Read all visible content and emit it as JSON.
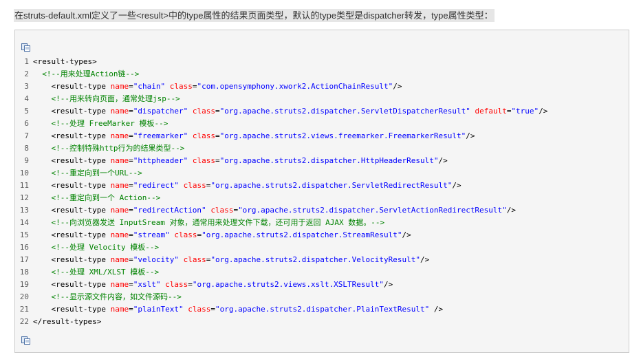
{
  "intro": "在struts-default.xml定义了一些<result>中的type属性的结果页面类型，默认的type类型是dispatcher转发，type属性类型：",
  "code_lines": [
    {
      "n": "1",
      "indent": "",
      "parts": [
        {
          "t": "tag",
          "v": "<result-types>"
        }
      ]
    },
    {
      "n": "2",
      "indent": "  ",
      "parts": [
        {
          "t": "cmt",
          "v": "<!--用来处理Action链-->"
        }
      ]
    },
    {
      "n": "3",
      "indent": "    ",
      "parts": [
        {
          "t": "tag",
          "v": "<result-type "
        },
        {
          "t": "attr",
          "v": "name"
        },
        {
          "t": "eq",
          "v": "="
        },
        {
          "t": "val",
          "v": "\"chain\""
        },
        {
          "t": "tag",
          "v": " "
        },
        {
          "t": "attr",
          "v": "class"
        },
        {
          "t": "eq",
          "v": "="
        },
        {
          "t": "val",
          "v": "\"com.opensymphony.xwork2.ActionChainResult\""
        },
        {
          "t": "tag",
          "v": "/>"
        }
      ]
    },
    {
      "n": "4",
      "indent": "    ",
      "parts": [
        {
          "t": "cmt",
          "v": "<!--用来转向页面，通常处理jsp-->"
        }
      ]
    },
    {
      "n": "5",
      "indent": "    ",
      "parts": [
        {
          "t": "tag",
          "v": "<result-type "
        },
        {
          "t": "attr",
          "v": "name"
        },
        {
          "t": "eq",
          "v": "="
        },
        {
          "t": "val",
          "v": "\"dispatcher\""
        },
        {
          "t": "tag",
          "v": " "
        },
        {
          "t": "attr",
          "v": "class"
        },
        {
          "t": "eq",
          "v": "="
        },
        {
          "t": "val",
          "v": "\"org.apache.struts2.dispatcher.ServletDispatcherResult\""
        },
        {
          "t": "tag",
          "v": " "
        },
        {
          "t": "attr",
          "v": "default"
        },
        {
          "t": "eq",
          "v": "="
        },
        {
          "t": "val",
          "v": "\"true\""
        },
        {
          "t": "tag",
          "v": "/>"
        }
      ]
    },
    {
      "n": "6",
      "indent": "    ",
      "parts": [
        {
          "t": "cmt",
          "v": "<!--处理 FreeMarker 模板-->"
        }
      ]
    },
    {
      "n": "7",
      "indent": "    ",
      "parts": [
        {
          "t": "tag",
          "v": "<result-type "
        },
        {
          "t": "attr",
          "v": "name"
        },
        {
          "t": "eq",
          "v": "="
        },
        {
          "t": "val",
          "v": "\"freemarker\""
        },
        {
          "t": "tag",
          "v": " "
        },
        {
          "t": "attr",
          "v": "class"
        },
        {
          "t": "eq",
          "v": "="
        },
        {
          "t": "val",
          "v": "\"org.apache.struts2.views.freemarker.FreemarkerResult\""
        },
        {
          "t": "tag",
          "v": "/>"
        }
      ]
    },
    {
      "n": "8",
      "indent": "    ",
      "parts": [
        {
          "t": "cmt",
          "v": "<!--控制特殊http行为的结果类型-->"
        }
      ]
    },
    {
      "n": "9",
      "indent": "    ",
      "parts": [
        {
          "t": "tag",
          "v": "<result-type "
        },
        {
          "t": "attr",
          "v": "name"
        },
        {
          "t": "eq",
          "v": "="
        },
        {
          "t": "val",
          "v": "\"httpheader\""
        },
        {
          "t": "tag",
          "v": " "
        },
        {
          "t": "attr",
          "v": "class"
        },
        {
          "t": "eq",
          "v": "="
        },
        {
          "t": "val",
          "v": "\"org.apache.struts2.dispatcher.HttpHeaderResult\""
        },
        {
          "t": "tag",
          "v": "/>"
        }
      ]
    },
    {
      "n": "10",
      "indent": "    ",
      "parts": [
        {
          "t": "cmt",
          "v": "<!--重定向到一个URL-->"
        }
      ]
    },
    {
      "n": "11",
      "indent": "    ",
      "parts": [
        {
          "t": "tag",
          "v": "<result-type "
        },
        {
          "t": "attr",
          "v": "name"
        },
        {
          "t": "eq",
          "v": "="
        },
        {
          "t": "val",
          "v": "\"redirect\""
        },
        {
          "t": "tag",
          "v": " "
        },
        {
          "t": "attr",
          "v": "class"
        },
        {
          "t": "eq",
          "v": "="
        },
        {
          "t": "val",
          "v": "\"org.apache.struts2.dispatcher.ServletRedirectResult\""
        },
        {
          "t": "tag",
          "v": "/>"
        }
      ]
    },
    {
      "n": "12",
      "indent": "    ",
      "parts": [
        {
          "t": "cmt",
          "v": "<!--重定向到一个 Action-->"
        }
      ]
    },
    {
      "n": "13",
      "indent": "    ",
      "parts": [
        {
          "t": "tag",
          "v": "<result-type "
        },
        {
          "t": "attr",
          "v": "name"
        },
        {
          "t": "eq",
          "v": "="
        },
        {
          "t": "val",
          "v": "\"redirectAction\""
        },
        {
          "t": "tag",
          "v": " "
        },
        {
          "t": "attr",
          "v": "class"
        },
        {
          "t": "eq",
          "v": "="
        },
        {
          "t": "val",
          "v": "\"org.apache.struts2.dispatcher.ServletActionRedirectResult\""
        },
        {
          "t": "tag",
          "v": "/>"
        }
      ]
    },
    {
      "n": "14",
      "indent": "    ",
      "parts": [
        {
          "t": "cmt",
          "v": "<!--向浏览器发送 InputSream 对象，通常用来处理文件下载，还可用于返回 AJAX 数据。-->"
        }
      ]
    },
    {
      "n": "15",
      "indent": "    ",
      "parts": [
        {
          "t": "tag",
          "v": "<result-type "
        },
        {
          "t": "attr",
          "v": "name"
        },
        {
          "t": "eq",
          "v": "="
        },
        {
          "t": "val",
          "v": "\"stream\""
        },
        {
          "t": "tag",
          "v": " "
        },
        {
          "t": "attr",
          "v": "class"
        },
        {
          "t": "eq",
          "v": "="
        },
        {
          "t": "val",
          "v": "\"org.apache.struts2.dispatcher.StreamResult\""
        },
        {
          "t": "tag",
          "v": "/>"
        }
      ]
    },
    {
      "n": "16",
      "indent": "    ",
      "parts": [
        {
          "t": "cmt",
          "v": "<!--处理 Velocity 模板-->"
        }
      ]
    },
    {
      "n": "17",
      "indent": "    ",
      "parts": [
        {
          "t": "tag",
          "v": "<result-type "
        },
        {
          "t": "attr",
          "v": "name"
        },
        {
          "t": "eq",
          "v": "="
        },
        {
          "t": "val",
          "v": "\"velocity\""
        },
        {
          "t": "tag",
          "v": " "
        },
        {
          "t": "attr",
          "v": "class"
        },
        {
          "t": "eq",
          "v": "="
        },
        {
          "t": "val",
          "v": "\"org.apache.struts2.dispatcher.VelocityResult\""
        },
        {
          "t": "tag",
          "v": "/>"
        }
      ]
    },
    {
      "n": "18",
      "indent": "    ",
      "parts": [
        {
          "t": "cmt",
          "v": "<!--处理 XML/XLST 模板-->"
        }
      ]
    },
    {
      "n": "19",
      "indent": "    ",
      "parts": [
        {
          "t": "tag",
          "v": "<result-type "
        },
        {
          "t": "attr",
          "v": "name"
        },
        {
          "t": "eq",
          "v": "="
        },
        {
          "t": "val",
          "v": "\"xslt\""
        },
        {
          "t": "tag",
          "v": " "
        },
        {
          "t": "attr",
          "v": "class"
        },
        {
          "t": "eq",
          "v": "="
        },
        {
          "t": "val",
          "v": "\"org.apache.struts2.views.xslt.XSLTResult\""
        },
        {
          "t": "tag",
          "v": "/>"
        }
      ]
    },
    {
      "n": "20",
      "indent": "    ",
      "parts": [
        {
          "t": "cmt",
          "v": "<!--显示源文件内容，如文件源码-->"
        }
      ]
    },
    {
      "n": "21",
      "indent": "    ",
      "parts": [
        {
          "t": "tag",
          "v": "<result-type "
        },
        {
          "t": "attr",
          "v": "name"
        },
        {
          "t": "eq",
          "v": "="
        },
        {
          "t": "val",
          "v": "\"plainText\""
        },
        {
          "t": "tag",
          "v": " "
        },
        {
          "t": "attr",
          "v": "class"
        },
        {
          "t": "eq",
          "v": "="
        },
        {
          "t": "val",
          "v": "\"org.apache.struts2.dispatcher.PlainTextResult\""
        },
        {
          "t": "tag",
          "v": " />"
        }
      ]
    },
    {
      "n": "22",
      "indent": "",
      "parts": [
        {
          "t": "tag",
          "v": "</result-types>"
        }
      ]
    }
  ],
  "icons": {
    "copy_top": "copy-icon",
    "copy_bottom": "copy-icon"
  },
  "colors": {
    "tag": "#000000",
    "attribute": "#ff0000",
    "value": "#0000ff",
    "comment": "#008200",
    "line_number": "#5c5c5c",
    "box_bg": "#f5f5f5",
    "intro_bg": "#e6e6e6"
  }
}
